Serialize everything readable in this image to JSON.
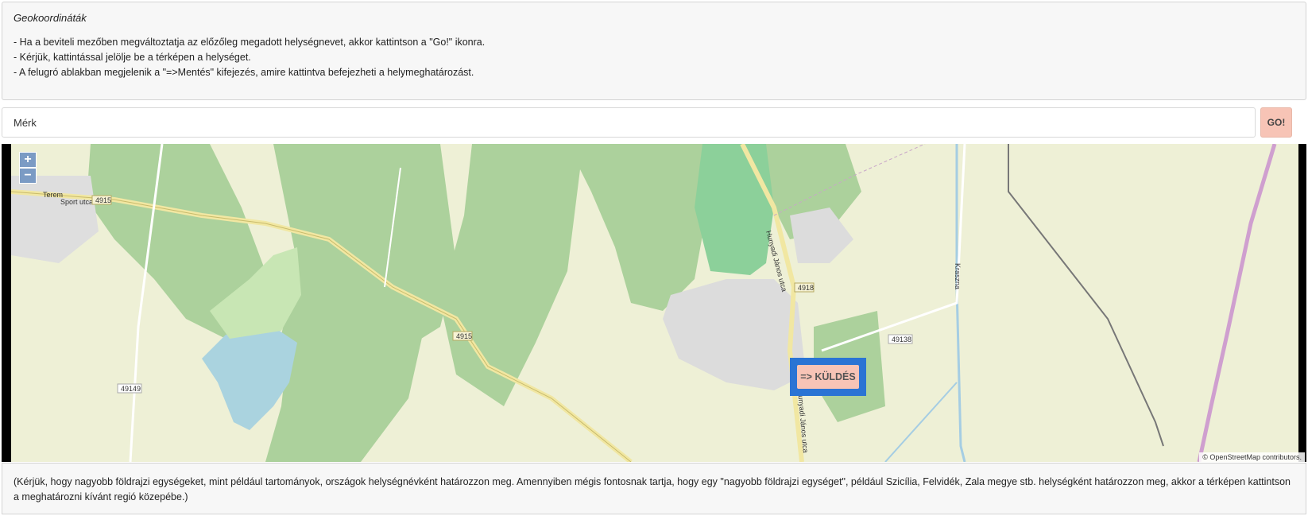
{
  "info": {
    "title": "Geokoordináták",
    "lines": [
      "- Ha a beviteli mezőben megváltoztatja az előzőleg megadott helységnevet, akkor kattintson a \"Go!\" ikonra.",
      "- Kérjük, kattintással jelölje be a térképen a helységet.",
      "- A felugró ablakban megjelenik a \"=>Mentés\" kifejezés, amire kattintva befejezheti a helymeghatározást."
    ]
  },
  "search": {
    "value": "Mérk",
    "go_label": "GO!"
  },
  "map": {
    "zoom_in": "+",
    "zoom_out": "−",
    "attribution": "© OpenStreetMap contributors.",
    "send_label": "=> KÜLDÉS",
    "labels": {
      "town": "Terem",
      "street": "Sport utca",
      "r4915a": "4915",
      "r4915b": "4915",
      "r4918": "4918",
      "r49138": "49138",
      "r49149": "49149",
      "hunyadi1": "Hunyadi János utca",
      "hunyadi2": "Hunyadi János utca",
      "krasznа": "Kraszna"
    }
  },
  "note": "(Kérjük, hogy nagyobb földrajzi egységeket, mint például tartományok, országok helységnévként határozzon meg. Amennyiben mégis fontosnak tartja, hogy egy \"nagyobb földrajzi egységet\", például Szicília, Felvidék, Zala megye stb. helységként határozzon meg, akkor a térképen kattintson a meghatározni kívánt regió közepébe.)"
}
